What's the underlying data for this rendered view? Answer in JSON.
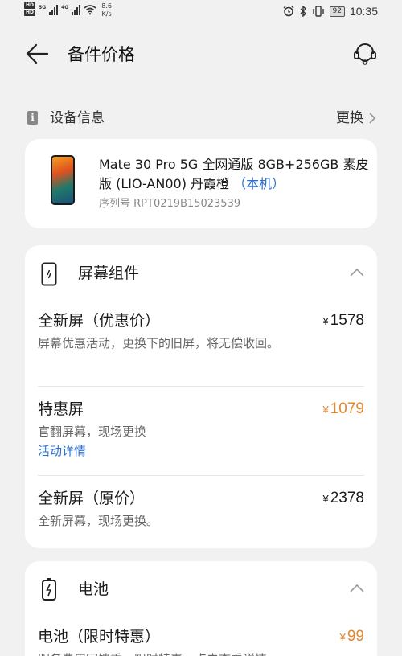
{
  "status_bar": {
    "hd1": "HD",
    "hd2": "HD",
    "net1": "5G",
    "net2": "4G",
    "speed_value": "8.6",
    "speed_unit": "K/s",
    "battery": "92",
    "time": "10:35"
  },
  "header": {
    "title": "备件价格"
  },
  "device_section": {
    "title": "设备信息",
    "change_label": "更换",
    "device_name": "Mate 30 Pro 5G 全网通版 8GB+256GB 素皮版 (LIO-AN00) 丹霞橙",
    "device_tag": "（本机）",
    "serial": "序列号 RPT0219B15023539"
  },
  "screen_card": {
    "title": "屏幕组件",
    "options": [
      {
        "name": "全新屏（优惠价）",
        "desc": "屏幕优惠活动，更换下的旧屏，将无偿收回。",
        "currency": "¥",
        "price": "1578"
      },
      {
        "name": "特惠屏",
        "desc": "官翻屏幕，现场更换",
        "link": "活动详情",
        "currency": "¥",
        "price": "1079"
      },
      {
        "name": "全新屏（原价）",
        "desc": "全新屏幕，现场更换。",
        "currency": "¥",
        "price": "2378"
      }
    ]
  },
  "battery_card": {
    "title": "电池",
    "options": [
      {
        "name": "电池（限时特惠）",
        "desc": "服务费用回馈季，限时特惠，点击查看详情",
        "currency": "¥",
        "price": "99"
      }
    ]
  },
  "colors": {
    "accent_blue": "#2c6fd1",
    "price_orange": "#e0882f",
    "background": "#f1f1f1"
  }
}
